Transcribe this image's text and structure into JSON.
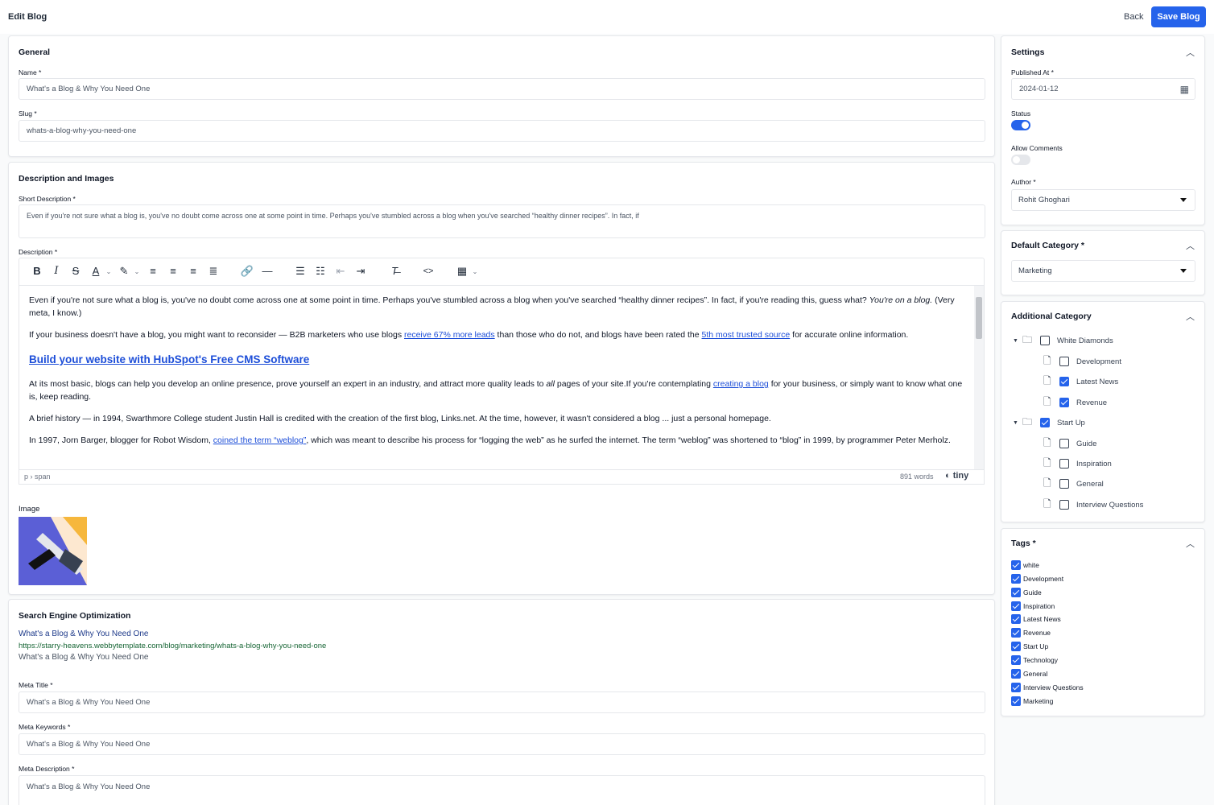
{
  "header": {
    "title": "Edit Blog",
    "back_label": "Back",
    "save_label": "Save Blog"
  },
  "general": {
    "title": "General",
    "name_label": "Name *",
    "name_value": "What's a Blog & Why You Need One",
    "slug_label": "Slug *",
    "slug_value": "whats-a-blog-why-you-need-one"
  },
  "description": {
    "title": "Description and Images",
    "short_label": "Short Description *",
    "short_value": "Even if you're not sure what a blog is, you've no doubt come across one at some point in time. Perhaps you've stumbled across a blog when you've searched “healthy dinner recipes”. In fact, if",
    "desc_label": "Description *",
    "editor": {
      "p1a": "Even if you're not sure what a blog is, you've no doubt come across one at some point in time. Perhaps you've stumbled across a blog when you've searched “healthy dinner recipes”. In fact, if you're reading this, guess what? ",
      "p1b": "You're on a blog.",
      "p1c": " (Very meta, I know.)",
      "p2a": "If your business doesn't have a blog, you might want to reconsider — B2B marketers who use blogs ",
      "p2_link1": "receive 67% more leads",
      "p2b": " than those who do not, and blogs have been rated the ",
      "p2_link2": "5th most trusted source",
      "p2c": " for accurate online information.",
      "heading": "Build your website with HubSpot's Free CMS Software",
      "p3a": "At its most basic, blogs can help you develop an online presence, prove yourself an expert in an industry, and attract more quality leads to ",
      "p3_em": "all",
      "p3b": " pages of your site.If you're contemplating ",
      "p3_link": "creating a blog",
      "p3c": " for your business, or simply want to know what one is, keep reading.",
      "p4": "A brief history — in 1994, Swarthmore College student Justin Hall is credited with the creation of the first blog, Links.net. At the time, however, it wasn't considered a blog ... just a personal homepage.",
      "p5a": "In 1997, Jorn Barger, blogger for Robot Wisdom, ",
      "p5_link": "coined the term “weblog”",
      "p5b": ", which was meant to describe his process for “logging the web” as he surfed the internet. The term “weblog” was shortened to “blog” in 1999, by programmer Peter Merholz."
    },
    "path": "p › span",
    "word_count": "891 words",
    "brand": "tiny",
    "image_label": "Image"
  },
  "seo": {
    "title": "Search Engine Optimization",
    "preview_title": "What's a Blog & Why You Need One",
    "preview_url": "https://starry-heavens.webbytemplate.com/blog/marketing/whats-a-blog-why-you-need-one",
    "preview_desc": "What's a Blog & Why You Need One",
    "meta_title_label": "Meta Title *",
    "meta_title_value": "What's a Blog & Why You Need One",
    "meta_keywords_label": "Meta Keywords *",
    "meta_keywords_value": "What's a Blog & Why You Need One",
    "meta_desc_label": "Meta Description *",
    "meta_desc_value": "What's a Blog & Why You Need One"
  },
  "settings": {
    "title": "Settings",
    "published_label": "Published At *",
    "published_value": "2024-01-12",
    "status_label": "Status",
    "status_on": true,
    "comments_label": "Allow Comments",
    "comments_on": false,
    "author_label": "Author *",
    "author_value": "Rohit Ghoghari"
  },
  "default_category": {
    "title": "Default Category *",
    "value": "Marketing"
  },
  "additional_category": {
    "title": "Additional Category",
    "groups": [
      {
        "name": "White Diamonds",
        "checked": false,
        "children": [
          {
            "name": "Development",
            "checked": false
          },
          {
            "name": "Latest News",
            "checked": true
          },
          {
            "name": "Revenue",
            "checked": true
          }
        ]
      },
      {
        "name": "Start Up",
        "checked": true,
        "children": [
          {
            "name": "Guide",
            "checked": false
          },
          {
            "name": "Inspiration",
            "checked": false
          },
          {
            "name": "General",
            "checked": false
          },
          {
            "name": "Interview Questions",
            "checked": false
          }
        ]
      }
    ]
  },
  "tags": {
    "title": "Tags *",
    "items": [
      {
        "name": "white",
        "checked": true
      },
      {
        "name": "Development",
        "checked": true
      },
      {
        "name": "Guide",
        "checked": true
      },
      {
        "name": "Inspiration",
        "checked": true
      },
      {
        "name": "Latest News",
        "checked": true
      },
      {
        "name": "Revenue",
        "checked": true
      },
      {
        "name": "Start Up",
        "checked": true
      },
      {
        "name": "Technology",
        "checked": true
      },
      {
        "name": "General",
        "checked": true
      },
      {
        "name": "Interview Questions",
        "checked": true
      },
      {
        "name": "Marketing",
        "checked": true
      }
    ]
  },
  "colors": {
    "accent": "#2563eb",
    "link": "#1d4ed8",
    "seo_url": "#166534"
  }
}
